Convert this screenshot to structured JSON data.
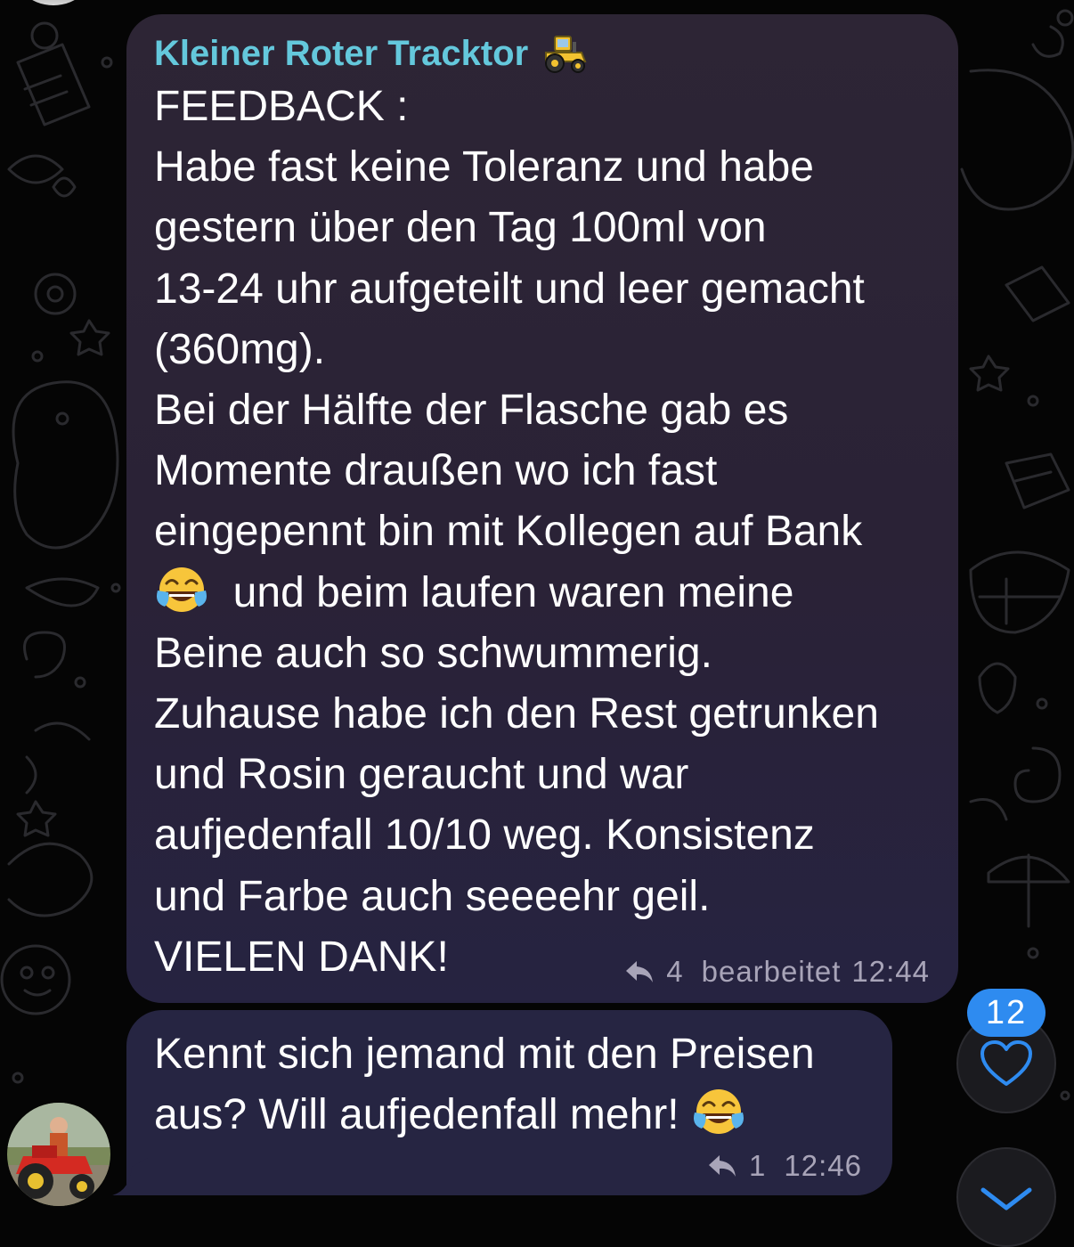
{
  "colors": {
    "background": "#050505",
    "bubble": "#2a2236",
    "sender_name": "#64c8dc",
    "meta_text": "#a8a4b8",
    "badge": "#2e8bf0",
    "icon_accent": "#2e8bf0"
  },
  "messages": [
    {
      "sender": "Kleiner Roter Tracktor",
      "sender_emoji": "tractor-emoji",
      "lines_before_emoji": "FEEDBACK :\nHabe fast keine Toleranz und habe\ngestern über den Tag 100ml von\n13-24 uhr aufgeteilt und leer gemacht\n(360mg).\nBei der Hälfte der Flasche gab es\nMomente draußen wo ich fast\neingepennt bin mit Kollegen auf Bank\n",
      "emoji": "face-with-tears-of-joy",
      "lines_after_emoji": "  und beim laufen waren meine\nBeine auch so schwummerig.\nZuhause habe ich den Rest getrunken\nund Rosin geraucht und war\naufjedenfall 10/10 weg. Konsistenz\nund Farbe auch seeeehr geil.\nVIELEN DANK!",
      "reply_icon": "reply-icon",
      "reply_count": "4",
      "edited_label": "bearbeitet",
      "time": "12:44"
    },
    {
      "text": "Kennt sich jemand mit den Preisen\naus? Will aufjedenfall mehr! ",
      "emoji": "face-with-tears-of-joy",
      "reply_icon": "reply-icon",
      "reply_count": "1",
      "time": "12:46"
    }
  ],
  "reactions_button": {
    "icon": "heart-icon",
    "badge_count": "12"
  },
  "scroll_down_button": {
    "icon": "chevron-down-icon"
  }
}
